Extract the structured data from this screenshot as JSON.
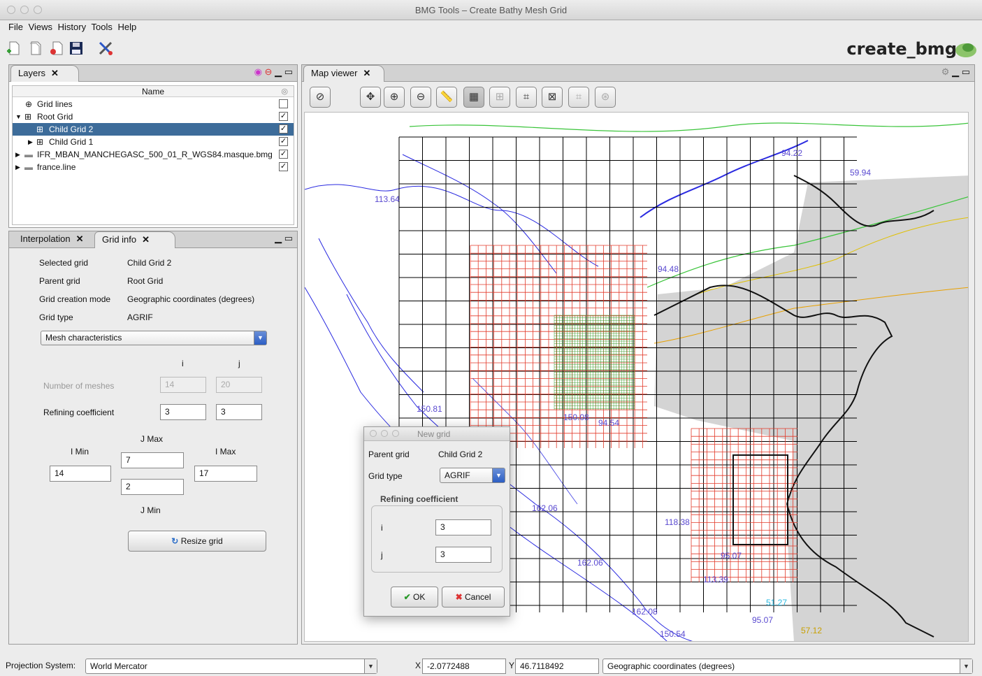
{
  "window": {
    "title": "BMG Tools – Create Bathy Mesh Grid"
  },
  "menu": [
    "File",
    "Views",
    "History",
    "Tools",
    "Help"
  ],
  "brand": "create_bmg",
  "layers_panel": {
    "tab_label": "Layers",
    "column_header": "Name",
    "rows": [
      {
        "label": "Grid lines",
        "checked": false,
        "selected": false
      },
      {
        "label": "Root Grid",
        "checked": true,
        "selected": false
      },
      {
        "label": "Child Grid 2",
        "checked": true,
        "selected": true
      },
      {
        "label": "Child Grid 1",
        "checked": true,
        "selected": false
      },
      {
        "label": "IFR_MBAN_MANCHEGASC_500_01_R_WGS84.masque.bmg",
        "checked": true,
        "selected": false
      },
      {
        "label": "france.line",
        "checked": true,
        "selected": false
      }
    ]
  },
  "info_panel": {
    "tabs": [
      "Interpolation",
      "Grid info"
    ],
    "selected_grid_label": "Selected grid",
    "selected_grid_value": "Child Grid 2",
    "parent_grid_label": "Parent grid",
    "parent_grid_value": "Root Grid",
    "creation_mode_label": "Grid creation mode",
    "creation_mode_value": "Geographic coordinates (degrees)",
    "grid_type_label": "Grid type",
    "grid_type_value": "AGRIF",
    "section_select": "Mesh characteristics",
    "col_i": "i",
    "col_j": "j",
    "num_meshes_label": "Number of meshes",
    "num_meshes_i": "14",
    "num_meshes_j": "20",
    "refining_label": "Refining coefficient",
    "refining_i": "3",
    "refining_j": "3",
    "jmax_label": "J Max",
    "jmax_value": "7",
    "imin_label": "I Min",
    "imin_value": "14",
    "imax_label": "I Max",
    "imax_value": "17",
    "jmin_label": "J Min",
    "jmin_value": "2",
    "resize_button": "Resize grid"
  },
  "map_viewer": {
    "tab_label": "Map viewer",
    "labels": [
      "113.64",
      "94.22",
      "59.94",
      "94.48",
      "94.54",
      "150.08",
      "150.81",
      "162.06",
      "162.06",
      "118.38",
      "95.07",
      "113.39",
      "95.07",
      "162.08",
      "150.54",
      "57.12",
      "51.27"
    ]
  },
  "new_grid_dialog": {
    "title": "New grid",
    "parent_grid_label": "Parent grid",
    "parent_grid_value": "Child Grid 2",
    "grid_type_label": "Grid type",
    "grid_type_value": "AGRIF",
    "refining_header": "Refining coefficient",
    "i_label": "i",
    "i_value": "3",
    "j_label": "j",
    "j_value": "3",
    "ok": "OK",
    "cancel": "Cancel"
  },
  "status": {
    "projection_label": "Projection System:",
    "projection_value": "World Mercator",
    "x_label": "X",
    "x_value": "-2.0772488",
    "y_label": "Y",
    "y_value": "46.7118492",
    "coord_mode": "Geographic coordinates (degrees)"
  },
  "colors": {
    "selection": "#3d6c9a",
    "red_grid": "#e23a2a",
    "green_grid": "#3a9a2a",
    "blue_contour": "#2a2ae0",
    "accent_blue": "#2c5ec4"
  }
}
